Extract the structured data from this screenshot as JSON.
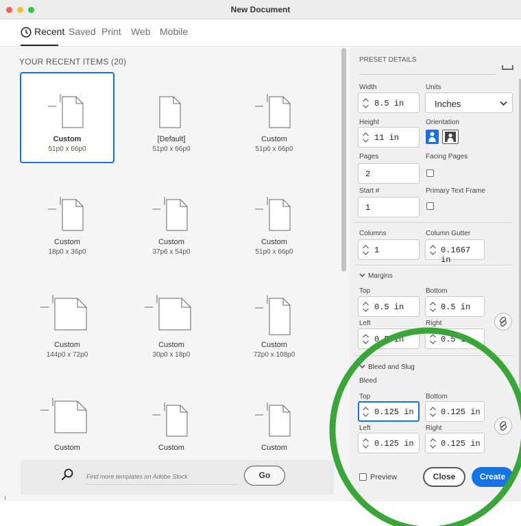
{
  "window": {
    "title": "New Document"
  },
  "tabs": [
    {
      "label": "Recent",
      "active": true
    },
    {
      "label": "Saved"
    },
    {
      "label": "Print"
    },
    {
      "label": "Web"
    },
    {
      "label": "Mobile"
    }
  ],
  "recent": {
    "heading": "YOUR RECENT ITEMS (20)",
    "items": [
      {
        "name": "Custom",
        "size": "51p0 x 66p0",
        "icon": "document-portrait-icon",
        "selected": true
      },
      {
        "name": "[Default]",
        "size": "51p0 x 66p0",
        "icon": "document-portrait-icon"
      },
      {
        "name": "Custom",
        "size": "51p0 x 66p0",
        "icon": "document-portrait-icon"
      },
      {
        "name": "Custom",
        "size": "18p0 x 36p0",
        "icon": "document-portrait-icon"
      },
      {
        "name": "Custom",
        "size": "37p6 x 54p0",
        "icon": "document-portrait-icon"
      },
      {
        "name": "Custom",
        "size": "51p0 x 66p0",
        "icon": "document-portrait-icon"
      },
      {
        "name": "Custom",
        "size": "144p0 x 72p0",
        "icon": "document-landscape-icon"
      },
      {
        "name": "Custom",
        "size": "30p0 x 18p0",
        "icon": "document-landscape-icon"
      },
      {
        "name": "Custom",
        "size": "72p0 x 108p0",
        "icon": "document-portrait-icon"
      },
      {
        "name": "Custom",
        "size": "",
        "icon": "document-landscape-icon"
      },
      {
        "name": "Custom",
        "size": "",
        "icon": "document-portrait-icon"
      },
      {
        "name": "Custom",
        "size": "",
        "icon": "document-portrait-icon"
      }
    ]
  },
  "search": {
    "placeholder": "Find more templates on Adobe Stock",
    "go_label": "Go",
    "icon": "search-icon"
  },
  "preset": {
    "heading": "PRESET DETAILS",
    "width_label": "Width",
    "width_value": "8.5 in",
    "units_label": "Units",
    "units_value": "Inches",
    "height_label": "Height",
    "height_value": "11 in",
    "orientation_label": "Orientation",
    "pages_label": "Pages",
    "pages_value": "2",
    "facing_label": "Facing Pages",
    "start_label": "Start #",
    "start_value": "1",
    "primary_label": "Primary Text Frame",
    "columns_label": "Columns",
    "columns_value": "1",
    "gutter_label": "Column Gutter",
    "gutter_value": "0.1667 in",
    "margins_heading": "Margins",
    "margins": {
      "top_label": "Top",
      "top": "0.5 in",
      "bottom_label": "Bottom",
      "bottom": "0.5 in",
      "left_label": "Left",
      "left": "0.5 in",
      "right_label": "Right",
      "right": "0.5 in"
    },
    "bleed_heading": "Bleed and Slug",
    "bleed_label": "Bleed",
    "bleed": {
      "top_label": "Top",
      "top": "0.125 in",
      "bottom_label": "Bottom",
      "bottom": "0.125 in",
      "left_label": "Left",
      "left": "0.125 in",
      "right_label": "Right",
      "right": "0.125 in"
    },
    "preview_label": "Preview",
    "close_label": "Close",
    "create_label": "Create"
  },
  "colors": {
    "accent": "#1473e6",
    "highlight_circle": "#3aa63a"
  }
}
